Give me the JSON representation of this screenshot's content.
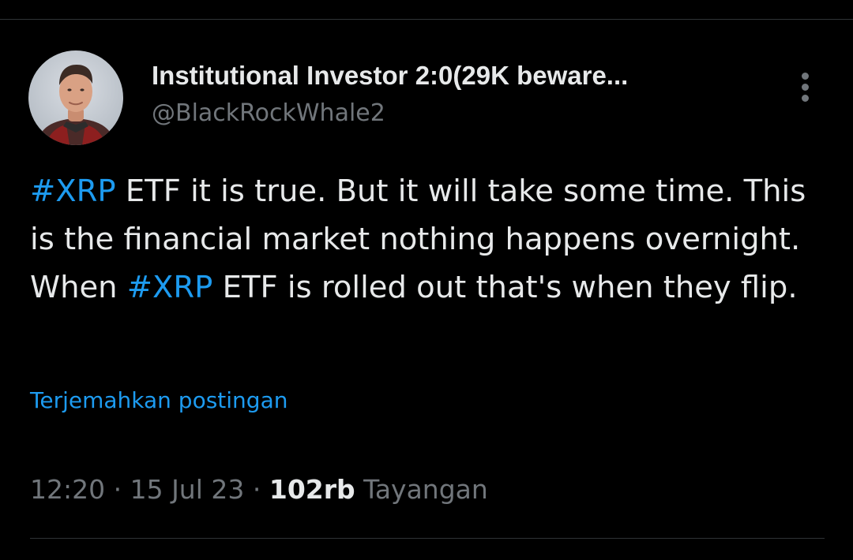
{
  "author": {
    "display_name": "Institutional Investor 2:0(29K beware...",
    "handle": "@BlackRockWhale2"
  },
  "tweet": {
    "hashtag_1": "#XRP",
    "text_1": " ETF it is true. But it will take some time. This is the financial market nothing happens overnight. When ",
    "hashtag_2": "#XRP",
    "text_2": " ETF is rolled out that's when they flip."
  },
  "translate_label": "Terjemahkan postingan",
  "meta": {
    "time": "12:20",
    "separator": " · ",
    "date": "15 Jul 23",
    "views_count": "102rb",
    "views_label": " Tayangan"
  },
  "icons": {
    "more": "more-vertical-icon",
    "avatar": "profile-photo"
  },
  "colors": {
    "background": "#000000",
    "text_primary": "#e7e9ea",
    "text_secondary": "#71767b",
    "link": "#1d9bf0",
    "divider": "#2f3336"
  }
}
